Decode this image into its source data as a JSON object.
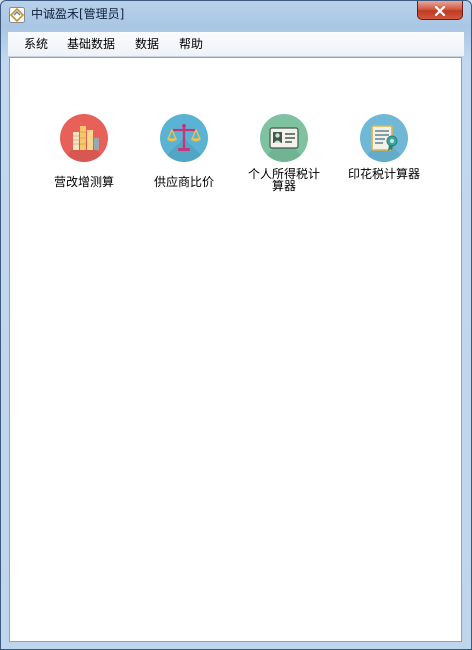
{
  "window": {
    "title": "中诚盈禾[管理员]"
  },
  "menu": {
    "items": [
      "系统",
      "基础数据",
      "数据",
      "帮助"
    ]
  },
  "tiles": [
    {
      "label": "营改增测算",
      "icon": "bar-chart-icon",
      "color": "#e8605a"
    },
    {
      "label": "供应商比价",
      "icon": "balance-scale-icon",
      "color": "#5bb3d3"
    },
    {
      "label": "个人所得税计算器",
      "icon": "id-card-icon",
      "color": "#7fc2a0"
    },
    {
      "label": "印花税计算器",
      "icon": "certificate-icon",
      "color": "#6fb9d6"
    }
  ],
  "colors": {
    "close": "#c13a22",
    "frame": "#b9d1ea"
  }
}
